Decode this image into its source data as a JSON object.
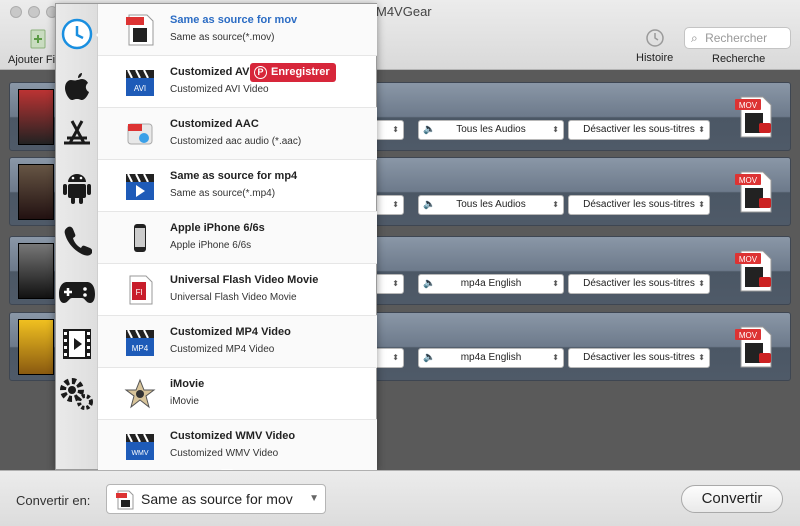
{
  "window": {
    "title": "M4VGear"
  },
  "toolbar": {
    "add_label": "Ajouter Fi",
    "history_label": "Histoire",
    "search_label": "Recherche",
    "search_placeholder": "Rechercher"
  },
  "rows": [
    {
      "audio": "Tous les Audios",
      "subtitle": "Désactiver les sous-titres",
      "format": "MOV"
    },
    {
      "audio": "Tous les Audios",
      "subtitle": "Désactiver les sous-titres",
      "format": "MOV"
    },
    {
      "audio": "mp4a English",
      "subtitle": "Désactiver les sous-titres",
      "format": "MOV"
    },
    {
      "audio": "mp4a English",
      "subtitle": "Désactiver les sous-titres",
      "format": "MOV"
    }
  ],
  "popup": {
    "categories": [
      "clock-icon",
      "apple-icon",
      "appstore-icon",
      "android-icon",
      "phone-icon",
      "gamepad-icon",
      "video-icon",
      "gears-icon"
    ],
    "items": [
      {
        "title": "Same as source for mov",
        "sub": "Same as source(*.mov)",
        "icon": "MOV"
      },
      {
        "title": "Customized AVI",
        "sub": "Customized AVI Video",
        "icon": "AVI"
      },
      {
        "title": "Customized AAC",
        "sub": "Customized aac audio (*.aac)",
        "icon": "AAC"
      },
      {
        "title": "Same as source for mp4",
        "sub": "Same as source(*.mp4)",
        "icon": "MP4"
      },
      {
        "title": "Apple iPhone 6/6s",
        "sub": "Apple iPhone 6/6s",
        "icon": "iPhone"
      },
      {
        "title": "Universal Flash Video Movie",
        "sub": "Universal Flash Video Movie",
        "icon": "FLV"
      },
      {
        "title": "Customized MP4 Video",
        "sub": "Customized MP4 Video",
        "icon": "MP4"
      },
      {
        "title": "iMovie",
        "sub": "iMovie",
        "icon": "iMovie"
      },
      {
        "title": "Customized WMV Video",
        "sub": "Customized WMV Video",
        "icon": "WMV"
      }
    ],
    "pin_label": "Enregistrer",
    "pin_glyph": "P"
  },
  "bottom": {
    "convert_to_label": "Convertir en:",
    "selected_format": "Same as source for mov",
    "convert_button": "Convertir"
  },
  "colors": {
    "accent": "#2b6cc4",
    "pinterest": "#d7263a"
  }
}
